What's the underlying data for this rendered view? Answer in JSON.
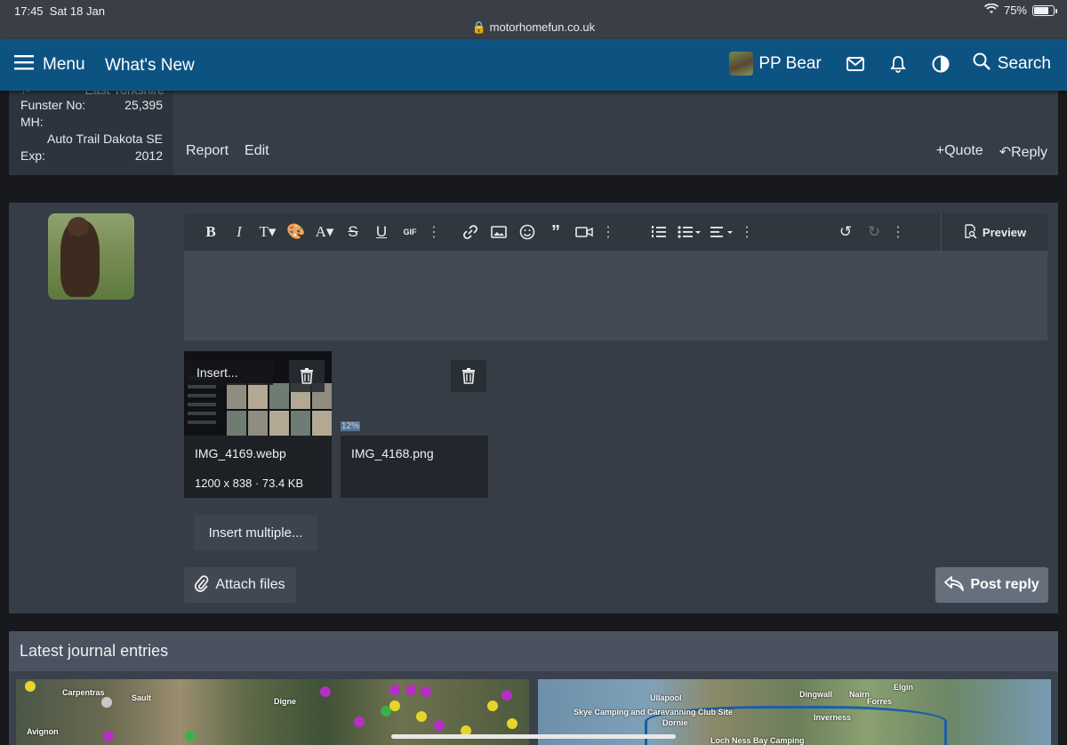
{
  "status_bar": {
    "time": "17:45",
    "date": "Sat 18 Jan",
    "url": "motorhomefun.co.uk",
    "battery_pct": "75%",
    "battery_level": 0.75
  },
  "nav": {
    "menu_label": "Menu",
    "whats_new_label": "What's New",
    "username": "PP Bear",
    "search_label": "Search"
  },
  "post_user": {
    "location_faded": "East Yorkshire",
    "funster_no_label": "Funster No:",
    "funster_no_value": "25,395",
    "mh_label": "MH:",
    "mh_value": "Auto Trail Dakota SE",
    "exp_label": "Exp:",
    "exp_value": "2012"
  },
  "post_actions": {
    "report": "Report",
    "edit": "Edit",
    "quote": "Quote",
    "reply": "Reply"
  },
  "editor": {
    "toolbar": [
      "bold-icon",
      "italic-icon",
      "text-size-icon",
      "palette-icon",
      "font-icon",
      "strike-icon",
      "underline-icon",
      "gif-icon",
      "link-icon",
      "image-icon",
      "smiley-icon",
      "quote-icon",
      "media-icon",
      "ordered-list-icon",
      "unordered-list-icon",
      "align-icon",
      "undo-icon",
      "redo-icon"
    ],
    "preview_label": "Preview"
  },
  "attachments": [
    {
      "insert_label": "Insert...",
      "filename": "IMG_4169.webp",
      "meta": "1200 x 838 · 73.4 KB"
    },
    {
      "filename": "IMG_4168.png",
      "progress_pct": "12%",
      "progress": 0.12
    }
  ],
  "buttons": {
    "insert_multiple": "Insert multiple...",
    "attach_files": "Attach files",
    "post_reply": "Post reply"
  },
  "journal": {
    "title": "Latest journal entries",
    "map1_labels": [
      "Carpentras",
      "Avignon",
      "Digne",
      "Sault"
    ],
    "map2_labels": [
      "Skye Camping and Caravanning Club Site",
      "Loch Ness Bay Camping",
      "Inverness",
      "Dingwall",
      "Nairn",
      "Forres",
      "Elgin",
      "Ullapool",
      "Dornie"
    ]
  },
  "colors": {
    "nav_bg": "#0d5382",
    "block_bg": "#363d47",
    "page_bg": "#17191d"
  }
}
